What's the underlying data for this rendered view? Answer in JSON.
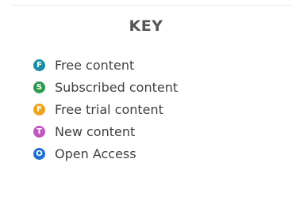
{
  "key": {
    "title": "KEY",
    "items": [
      {
        "icon": "free-content-icon",
        "letter": "F",
        "label": "Free content",
        "color": "#1b8fa6"
      },
      {
        "icon": "subscribed-content-icon",
        "letter": "S",
        "label": "Subscribed content",
        "color": "#2e9a4e"
      },
      {
        "icon": "free-trial-content-icon",
        "letter": "F",
        "label": "Free trial content",
        "color": "#f0a21b"
      },
      {
        "icon": "new-content-icon",
        "letter": "T",
        "label": "New content",
        "color": "#c058bf"
      },
      {
        "icon": "open-access-icon",
        "letter": "O",
        "label": "Open Access",
        "color": "#1f6fd0"
      }
    ]
  }
}
